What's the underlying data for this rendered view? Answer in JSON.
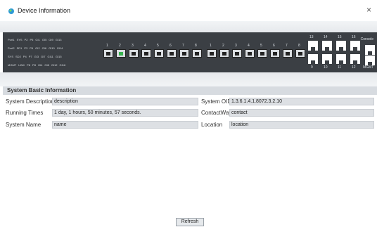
{
  "window": {
    "title": "Device Information",
    "close_label": "×"
  },
  "panel": {
    "legend_rows": [
      [
        "Port1",
        "SYS",
        "P2",
        "P5",
        "GI1",
        "GI5",
        "GI9",
        "GI13"
      ],
      [
        "Port2",
        "SD1",
        "P3",
        "P6",
        "GI2",
        "GI6",
        "GI10",
        "GI14"
      ],
      [
        "SYS",
        "SD2",
        "P4",
        "P7",
        "GI3",
        "GI7",
        "GI11",
        "GI15"
      ],
      [
        "MGMT",
        "LINK",
        "P8",
        "P8",
        "GI4",
        "GI8",
        "GI12",
        "GI16"
      ]
    ],
    "sfp_ports": [
      {
        "num": "1",
        "active": false
      },
      {
        "num": "2",
        "active": true
      },
      {
        "num": "3",
        "active": false
      },
      {
        "num": "4",
        "active": false
      },
      {
        "num": "5",
        "active": false
      },
      {
        "num": "6",
        "active": false
      },
      {
        "num": "7",
        "active": false
      },
      {
        "num": "8",
        "active": false
      }
    ],
    "rj45_top": [
      "13",
      "14",
      "15",
      "16"
    ],
    "rj45_bottom": [
      "9",
      "10",
      "11",
      "12"
    ],
    "console_label": "Console",
    "mgmt_label": "MGMT"
  },
  "info": {
    "section_title": "System Basic Information",
    "system_description_label": "System Description",
    "system_description": "description",
    "running_times_label": "Running Times",
    "running_times": "1 day, 1 hours, 50 minutes, 57 seconds.",
    "system_name_label": "System Name",
    "system_name": "name",
    "system_oid_label": "System OID",
    "system_oid": "1.3.6.1.4.1.8072.3.2.10",
    "contact_way_label": "ContactWay",
    "contact_way": "contact",
    "location_label": "Location",
    "location": "location"
  },
  "refresh_label": "Refresh"
}
